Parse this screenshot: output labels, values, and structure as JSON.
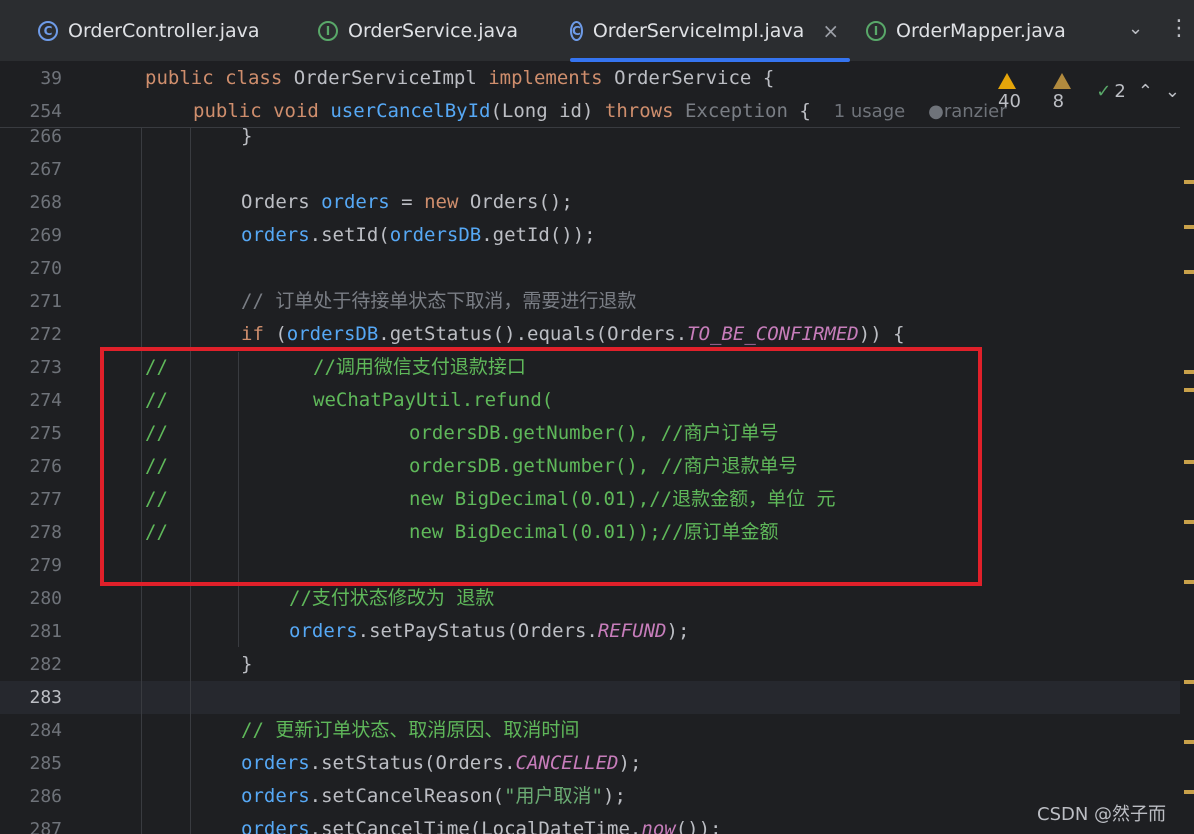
{
  "tabs": [
    {
      "label": "OrderController.java",
      "icon": "class-icon",
      "icon_glyph": "C",
      "active": false
    },
    {
      "label": "OrderService.java",
      "icon": "interface-icon",
      "icon_glyph": "I",
      "active": false
    },
    {
      "label": "OrderServiceImpl.java",
      "icon": "class-icon",
      "icon_glyph": "C",
      "active": true
    },
    {
      "label": "OrderMapper.java",
      "icon": "interface-icon",
      "icon_glyph": "I",
      "active": false
    }
  ],
  "tab_close_glyph": "×",
  "tab_menu_glyph": "⌄",
  "more_glyph": "⋮",
  "inspections": {
    "warnings": "40",
    "weak_warnings": "8",
    "ok": "2",
    "up_glyph": "⌃",
    "down_glyph": "⌄"
  },
  "sticky": {
    "line1": {
      "num": "39",
      "public": "public",
      "class": "class",
      "name": "OrderServiceImpl",
      "implements": "implements",
      "iface": "OrderService",
      "brace": "{"
    },
    "line2": {
      "num": "254",
      "public": "public",
      "void": "void",
      "method": "userCancelById",
      "params_open": "(Long id)",
      "throws": "throws",
      "exc": "Exception",
      "brace": "{",
      "usage": "1 usage",
      "author": "ranzier"
    }
  },
  "lines": [
    {
      "num": "266",
      "text": "        }"
    },
    {
      "num": "267",
      "text": ""
    },
    {
      "num": "268",
      "text": "Orders orders = new Orders();"
    },
    {
      "num": "269",
      "text": "orders.setId(ordersDB.getId());"
    },
    {
      "num": "270",
      "text": ""
    },
    {
      "num": "271",
      "text": "// 订单处于待接单状态下取消，需要进行退款"
    },
    {
      "num": "272",
      "text": "if (ordersDB.getStatus().equals(Orders.TO_BE_CONFIRMED)) {"
    },
    {
      "num": "273",
      "text": "//            //调用微信支付退款接口"
    },
    {
      "num": "274",
      "text": "//            weChatPayUtil.refund("
    },
    {
      "num": "275",
      "text": "//                    ordersDB.getNumber(), //商户订单号"
    },
    {
      "num": "276",
      "text": "//                    ordersDB.getNumber(), //商户退款单号"
    },
    {
      "num": "277",
      "text": "//                    new BigDecimal(0.01),//退款金额，单位 元"
    },
    {
      "num": "278",
      "text": "//                    new BigDecimal(0.01));//原订单金额"
    },
    {
      "num": "279",
      "text": ""
    },
    {
      "num": "280",
      "text": "//支付状态修改为 退款"
    },
    {
      "num": "281",
      "text": "orders.setPayStatus(Orders.REFUND);"
    },
    {
      "num": "282",
      "text": "}"
    },
    {
      "num": "283",
      "text": ""
    },
    {
      "num": "284",
      "text": "// 更新订单状态、取消原因、取消时间"
    },
    {
      "num": "285",
      "text": "orders.setStatus(Orders.CANCELLED);"
    },
    {
      "num": "286",
      "text": "orders.setCancelReason(\"用户取消\");"
    },
    {
      "num": "287",
      "text": "orders.setCancelTime(LocalDateTime.now());"
    }
  ],
  "tokens": {
    "orders_cls": "Orders",
    "orders_var": "orders",
    "eq": " = ",
    "new": "new",
    "orders_ctor": " Orders();",
    "set_id": ".setId(",
    "ordersDB": "ordersDB",
    "get_id": ".getId());",
    "cm271": "// 订单处于待接单状态下取消，需要进行退款",
    "if": "if",
    "paren": " (",
    "get_status": ".getStatus().equals(Orders.",
    "to_be_confirmed": "TO_BE_CONFIRMED",
    "close_if": ")) {",
    "slashes": "//",
    "c273": "//调用微信支付退款接口",
    "c274": "weChatPayUtil.refund(",
    "c275": "ordersDB.getNumber(), //商户订单号",
    "c276": "ordersDB.getNumber(), //商户退款单号",
    "c277": "new BigDecimal(0.01),//退款金额，单位 元",
    "c278": "new BigDecimal(0.01));//原订单金额",
    "cm280": "//支付状态修改为 退款",
    "set_pay": ".setPayStatus(Orders.",
    "refund": "REFUND",
    "close": ");",
    "rbrace": "}",
    "rbrace_top": "}",
    "cm284": "// 更新订单状态、取消原因、取消时间",
    "set_status": ".setStatus(Orders.",
    "cancelled": "CANCELLED",
    "close2": ");",
    "set_reason": ".setCancelReason(",
    "reason_str": "\"用户取消\"",
    "close3": ");",
    "set_time": ".setCancelTime(LocalDateTime.",
    "now": "now",
    "close4": "());"
  },
  "watermark": "CSDN @然子而",
  "colors": {
    "accent": "#3574f0",
    "highlight_box": "#e0202a",
    "keyword": "#cf8e6d",
    "method": "#56a8f5",
    "comment_green": "#5fb85a",
    "field": "#c77dbb"
  }
}
